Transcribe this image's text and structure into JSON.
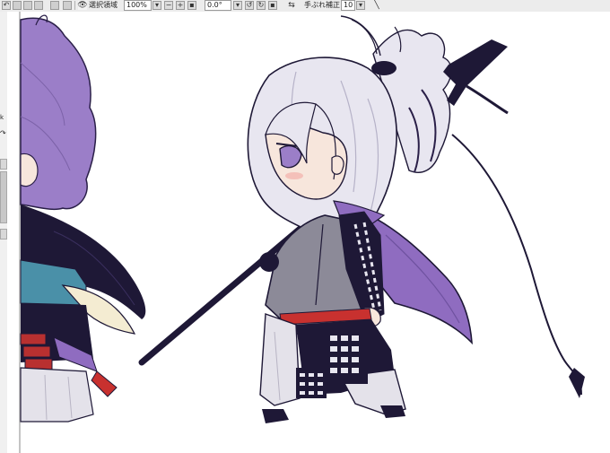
{
  "toolbar": {
    "undo_icon": "undo-icon",
    "redo_icon": "redo-icon",
    "view_icon": "eye-icon",
    "selection_label": "選択領域",
    "zoom_value": "100%",
    "angle_value": "0.0°",
    "swap_icon": "swap-icon",
    "stabilizer_label": "手ぶれ補正",
    "stabilizer_value": "10",
    "pen_icon": "pen-icon"
  },
  "left_panel": {
    "glyph_1": "k",
    "glyph_2": "↷"
  },
  "colors": {
    "ui_bg": "#ececec",
    "hair_purple": "#9b7ec8",
    "robe_dark": "#1e1836",
    "cape_purple": "#8f6cc0",
    "sash_red": "#c8312f",
    "skin": "#f7e6dc",
    "hair_white": "#e8e6f0"
  }
}
